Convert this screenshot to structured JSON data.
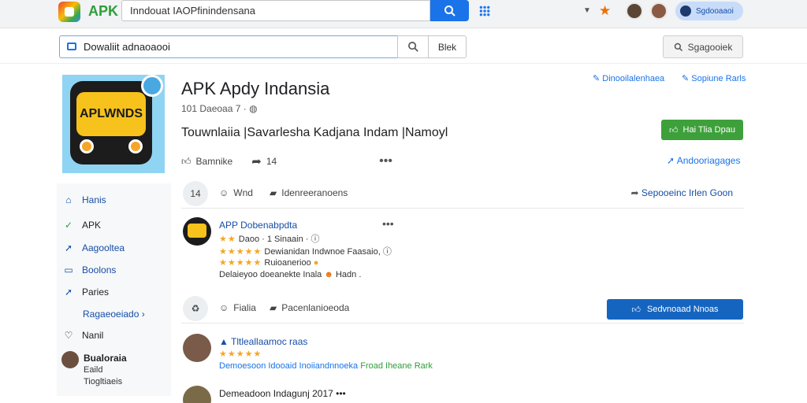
{
  "topbar": {
    "brand": "APK",
    "search_value": "Inndouat IAOPfinindensana",
    "account_label": "Sgdooaaoi"
  },
  "subbar": {
    "input_value": "Dowaliit adnaoaooi",
    "button_label": "Blek",
    "right_button_label": "Sgagooiek"
  },
  "app": {
    "icon_text": "APLWNDS",
    "title": "APK Apdy Indansia",
    "meta": "101 Daeoaa 7 ·",
    "description": "Touwnlaiia |Savarlesha Kadjana Indam |Namoyl",
    "action_like": "Bamnike",
    "action_share": "14",
    "link_top_1": "Dinooilalenhaea",
    "link_top_2": "Sopiune Rarls",
    "install_label": "Hai Tlia Dpau",
    "link_side": "Andooriagages"
  },
  "sidebar": {
    "items": [
      {
        "icon": "home-icon",
        "glyph": "⌂",
        "label": "Hanis"
      },
      {
        "icon": "check-icon",
        "glyph": "✓",
        "label": "APK"
      },
      {
        "icon": "arrow-icon",
        "glyph": "➚",
        "label": "Aagooltea"
      },
      {
        "icon": "folder-icon",
        "glyph": "▭",
        "label": "Boolons"
      },
      {
        "icon": "arrow-icon",
        "glyph": "➚",
        "label": "Paries"
      },
      {
        "icon": "",
        "glyph": "",
        "label": "Ragaeoeiado ›"
      },
      {
        "icon": "heart-icon",
        "glyph": "♡",
        "label": "Nanil"
      }
    ],
    "person": {
      "name": "Bualoraia",
      "line2": "Eaild",
      "line3": "Tiogltiaeis"
    }
  },
  "feed": {
    "bar1": {
      "count": "14",
      "item1": "Wnd",
      "item2": "Idenreeranoens",
      "share": "Sepooeinc Irlen Goon"
    },
    "post1": {
      "title": "APP Dobenabpdta",
      "line1": "Daoo · 1 Sinaain ·",
      "line2": "Dewianidan Indwnoe Faasaio,",
      "line3": "Ruioanerioo",
      "line4_a": "Delaieyoo doeanekte Inala",
      "line4_b": "Hadn ."
    },
    "bar2": {
      "item1": "Fialia",
      "item2": "Pacenlanioeoda",
      "button": "Sedvnoaad Nnoas"
    },
    "post2": {
      "title": "Tltleallaamoc raas",
      "line1_a": "Demoesoon Idooaid",
      "line1_b": "Inoiiandnnoeka",
      "line1_c": "Froad Iheane Rark"
    },
    "post3": {
      "title": "Demeadoon Indagunj",
      "meta": "2017"
    }
  },
  "colors": {
    "accent": "#1a73e8",
    "install": "#3ea03b",
    "primary_button": "#1565c0",
    "star": "#f5a623"
  }
}
